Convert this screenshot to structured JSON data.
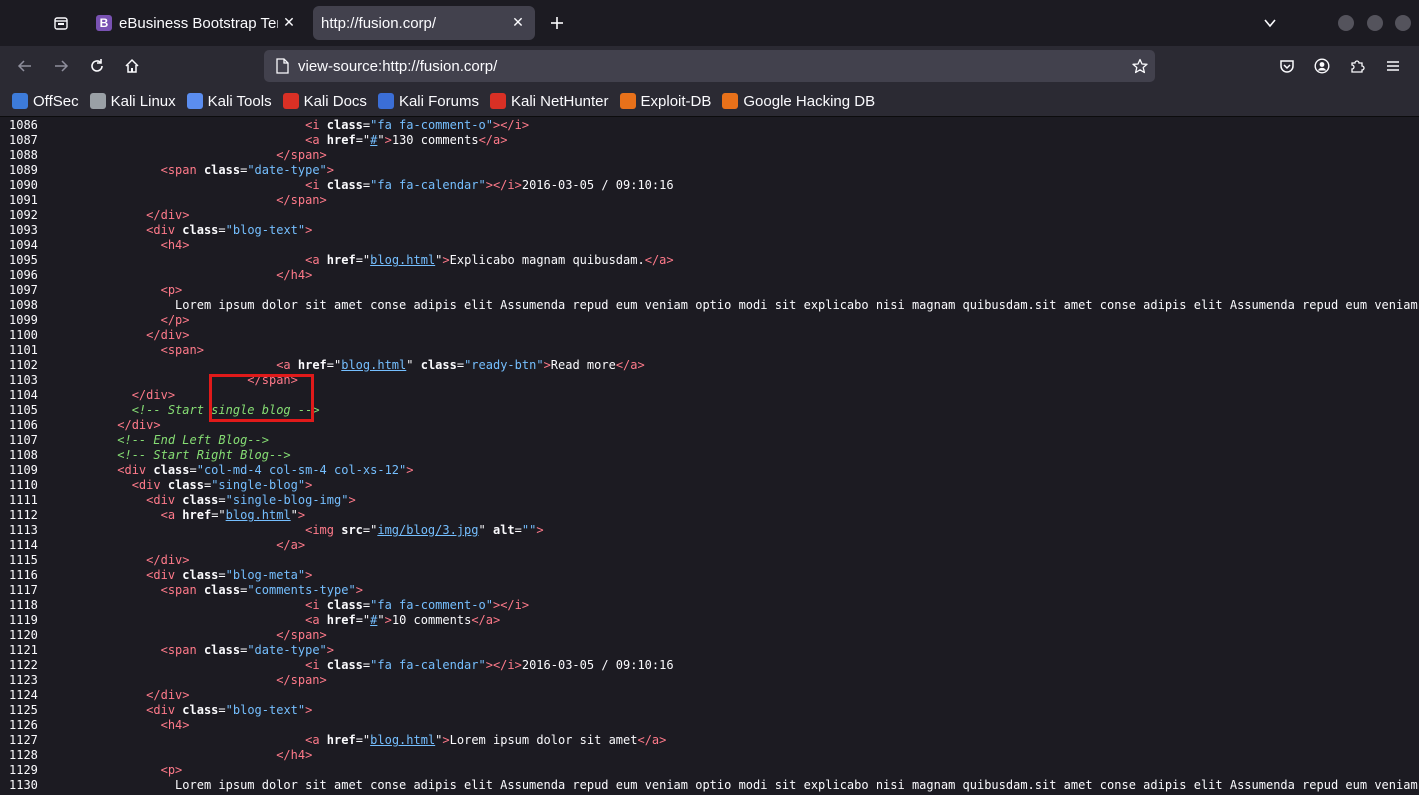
{
  "tabs": [
    {
      "title": "eBusiness Bootstrap Template",
      "favicon": "B",
      "active": false
    },
    {
      "title": "http://fusion.corp/",
      "active": true
    }
  ],
  "nav": {
    "url": "view-source:http://fusion.corp/"
  },
  "bookmarks": [
    {
      "label": "OffSec",
      "icon": "offsec-icon",
      "color": "#3d7bd9"
    },
    {
      "label": "Kali Linux",
      "icon": "kali-dragon-icon",
      "color": "#9aa0a6"
    },
    {
      "label": "Kali Tools",
      "icon": "kali-tools-icon",
      "color": "#5b8def"
    },
    {
      "label": "Kali Docs",
      "icon": "kali-docs-icon",
      "color": "#d93025"
    },
    {
      "label": "Kali Forums",
      "icon": "kali-forums-icon",
      "color": "#3b6ed6"
    },
    {
      "label": "Kali NetHunter",
      "icon": "nethunter-icon",
      "color": "#d93025"
    },
    {
      "label": "Exploit-DB",
      "icon": "exploit-db-icon",
      "color": "#e8711a"
    },
    {
      "label": "Google Hacking DB",
      "icon": "ghdb-icon",
      "color": "#e8711a"
    }
  ],
  "source_lines": [
    {
      "n": "1086",
      "parts": [
        [
          "sp",
          "                                    "
        ],
        [
          "tg",
          "<i "
        ],
        [
          "at",
          "class"
        ],
        [
          "tx",
          "="
        ],
        [
          "av",
          "\"fa fa-comment-o\""
        ],
        [
          "tg",
          "></i>"
        ]
      ]
    },
    {
      "n": "1087",
      "parts": [
        [
          "sp",
          "                                    "
        ],
        [
          "tg",
          "<a "
        ],
        [
          "at",
          "href"
        ],
        [
          "tx",
          "="
        ],
        [
          "tx",
          "\""
        ],
        [
          "lk",
          "#"
        ],
        [
          "tx",
          "\""
        ],
        [
          "tg",
          ">"
        ],
        [
          "tx",
          "130 comments"
        ],
        [
          "tg",
          "</a>"
        ]
      ]
    },
    {
      "n": "1088",
      "parts": [
        [
          "sp",
          "                                "
        ],
        [
          "tg",
          "</span>"
        ]
      ]
    },
    {
      "n": "1089",
      "parts": [
        [
          "sp",
          "                "
        ],
        [
          "tg",
          "<span "
        ],
        [
          "at",
          "class"
        ],
        [
          "tx",
          "="
        ],
        [
          "av",
          "\"date-type\""
        ],
        [
          "tg",
          ">"
        ]
      ]
    },
    {
      "n": "1090",
      "parts": [
        [
          "sp",
          "                                    "
        ],
        [
          "tg",
          "<i "
        ],
        [
          "at",
          "class"
        ],
        [
          "tx",
          "="
        ],
        [
          "av",
          "\"fa fa-calendar\""
        ],
        [
          "tg",
          "></i>"
        ],
        [
          "tx",
          "2016-03-05 / 09:10:16"
        ]
      ]
    },
    {
      "n": "1091",
      "parts": [
        [
          "sp",
          "                                "
        ],
        [
          "tg",
          "</span>"
        ]
      ]
    },
    {
      "n": "1092",
      "parts": [
        [
          "sp",
          "              "
        ],
        [
          "tg",
          "</div>"
        ]
      ]
    },
    {
      "n": "1093",
      "parts": [
        [
          "sp",
          "              "
        ],
        [
          "tg",
          "<div "
        ],
        [
          "at",
          "class"
        ],
        [
          "tx",
          "="
        ],
        [
          "av",
          "\"blog-text\""
        ],
        [
          "tg",
          ">"
        ]
      ]
    },
    {
      "n": "1094",
      "parts": [
        [
          "sp",
          "                "
        ],
        [
          "tg",
          "<h4>"
        ]
      ]
    },
    {
      "n": "1095",
      "parts": [
        [
          "sp",
          "                                    "
        ],
        [
          "tg",
          "<a "
        ],
        [
          "at",
          "href"
        ],
        [
          "tx",
          "=\""
        ],
        [
          "lk",
          "blog.html"
        ],
        [
          "tx",
          "\""
        ],
        [
          "tg",
          ">"
        ],
        [
          "tx",
          "Explicabo magnam quibusdam."
        ],
        [
          "tg",
          "</a>"
        ]
      ]
    },
    {
      "n": "1096",
      "parts": [
        [
          "sp",
          "                                "
        ],
        [
          "tg",
          "</h4>"
        ]
      ]
    },
    {
      "n": "1097",
      "parts": [
        [
          "sp",
          "                "
        ],
        [
          "tg",
          "<p>"
        ]
      ]
    },
    {
      "n": "1098",
      "parts": [
        [
          "sp",
          "                  "
        ],
        [
          "tx",
          "Lorem ipsum dolor sit amet conse adipis elit Assumenda repud eum veniam optio modi sit explicabo nisi magnam quibusdam.sit amet conse adipis elit Assumenda repud eum veniam"
        ]
      ]
    },
    {
      "n": "1099",
      "parts": [
        [
          "sp",
          "                "
        ],
        [
          "tg",
          "</p>"
        ]
      ]
    },
    {
      "n": "1100",
      "parts": [
        [
          "sp",
          "              "
        ],
        [
          "tg",
          "</div>"
        ]
      ]
    },
    {
      "n": "1101",
      "parts": [
        [
          "sp",
          "                "
        ],
        [
          "tg",
          "<span>"
        ]
      ]
    },
    {
      "n": "1102",
      "parts": [
        [
          "sp",
          "                                "
        ],
        [
          "tg",
          "<a "
        ],
        [
          "at",
          "href"
        ],
        [
          "tx",
          "=\""
        ],
        [
          "lk",
          "blog.html"
        ],
        [
          "tx",
          "\" "
        ],
        [
          "at",
          "class"
        ],
        [
          "tx",
          "="
        ],
        [
          "av",
          "\"ready-btn\""
        ],
        [
          "tg",
          ">"
        ],
        [
          "tx",
          "Read more"
        ],
        [
          "tg",
          "</a>"
        ]
      ]
    },
    {
      "n": "1103",
      "parts": [
        [
          "sp",
          "                            "
        ],
        [
          "tg",
          "</span>"
        ]
      ]
    },
    {
      "n": "1104",
      "parts": [
        [
          "sp",
          "            "
        ],
        [
          "tg",
          "</div>"
        ]
      ]
    },
    {
      "n": "1105",
      "parts": [
        [
          "sp",
          "            "
        ],
        [
          "cm",
          "<!-- Start single blog -->"
        ]
      ]
    },
    {
      "n": "1106",
      "parts": [
        [
          "sp",
          "          "
        ],
        [
          "tg",
          "</div>"
        ]
      ]
    },
    {
      "n": "1107",
      "parts": [
        [
          "sp",
          "          "
        ],
        [
          "cm",
          "<!-- End Left Blog-->"
        ]
      ]
    },
    {
      "n": "1108",
      "parts": [
        [
          "sp",
          "          "
        ],
        [
          "cm",
          "<!-- Start Right Blog-->"
        ]
      ]
    },
    {
      "n": "1109",
      "parts": [
        [
          "sp",
          "          "
        ],
        [
          "tg",
          "<div "
        ],
        [
          "at",
          "class"
        ],
        [
          "tx",
          "="
        ],
        [
          "av",
          "\"col-md-4 col-sm-4 col-xs-12\""
        ],
        [
          "tg",
          ">"
        ]
      ]
    },
    {
      "n": "1110",
      "parts": [
        [
          "sp",
          "            "
        ],
        [
          "tg",
          "<div "
        ],
        [
          "at",
          "class"
        ],
        [
          "tx",
          "="
        ],
        [
          "av",
          "\"single-blog\""
        ],
        [
          "tg",
          ">"
        ]
      ]
    },
    {
      "n": "1111",
      "parts": [
        [
          "sp",
          "              "
        ],
        [
          "tg",
          "<div "
        ],
        [
          "at",
          "class"
        ],
        [
          "tx",
          "="
        ],
        [
          "av",
          "\"single-blog-img\""
        ],
        [
          "tg",
          ">"
        ]
      ]
    },
    {
      "n": "1112",
      "parts": [
        [
          "sp",
          "                "
        ],
        [
          "tg",
          "<a "
        ],
        [
          "at",
          "href"
        ],
        [
          "tx",
          "=\""
        ],
        [
          "lk",
          "blog.html"
        ],
        [
          "tx",
          "\""
        ],
        [
          "tg",
          ">"
        ]
      ]
    },
    {
      "n": "1113",
      "parts": [
        [
          "sp",
          "                                    "
        ],
        [
          "tg",
          "<img "
        ],
        [
          "at",
          "src"
        ],
        [
          "tx",
          "=\""
        ],
        [
          "lk",
          "img/blog/3.jpg"
        ],
        [
          "tx",
          "\" "
        ],
        [
          "at",
          "alt"
        ],
        [
          "tx",
          "="
        ],
        [
          "av",
          "\"\""
        ],
        [
          "tg",
          ">"
        ]
      ]
    },
    {
      "n": "1114",
      "parts": [
        [
          "sp",
          "                                "
        ],
        [
          "tg",
          "</a>"
        ]
      ]
    },
    {
      "n": "1115",
      "parts": [
        [
          "sp",
          "              "
        ],
        [
          "tg",
          "</div>"
        ]
      ]
    },
    {
      "n": "1116",
      "parts": [
        [
          "sp",
          "              "
        ],
        [
          "tg",
          "<div "
        ],
        [
          "at",
          "class"
        ],
        [
          "tx",
          "="
        ],
        [
          "av",
          "\"blog-meta\""
        ],
        [
          "tg",
          ">"
        ]
      ]
    },
    {
      "n": "1117",
      "parts": [
        [
          "sp",
          "                "
        ],
        [
          "tg",
          "<span "
        ],
        [
          "at",
          "class"
        ],
        [
          "tx",
          "="
        ],
        [
          "av",
          "\"comments-type\""
        ],
        [
          "tg",
          ">"
        ]
      ]
    },
    {
      "n": "1118",
      "parts": [
        [
          "sp",
          "                                    "
        ],
        [
          "tg",
          "<i "
        ],
        [
          "at",
          "class"
        ],
        [
          "tx",
          "="
        ],
        [
          "av",
          "\"fa fa-comment-o\""
        ],
        [
          "tg",
          "></i>"
        ]
      ]
    },
    {
      "n": "1119",
      "parts": [
        [
          "sp",
          "                                    "
        ],
        [
          "tg",
          "<a "
        ],
        [
          "at",
          "href"
        ],
        [
          "tx",
          "=\""
        ],
        [
          "lk",
          "#"
        ],
        [
          "tx",
          "\""
        ],
        [
          "tg",
          ">"
        ],
        [
          "tx",
          "10 comments"
        ],
        [
          "tg",
          "</a>"
        ]
      ]
    },
    {
      "n": "1120",
      "parts": [
        [
          "sp",
          "                                "
        ],
        [
          "tg",
          "</span>"
        ]
      ]
    },
    {
      "n": "1121",
      "parts": [
        [
          "sp",
          "                "
        ],
        [
          "tg",
          "<span "
        ],
        [
          "at",
          "class"
        ],
        [
          "tx",
          "="
        ],
        [
          "av",
          "\"date-type\""
        ],
        [
          "tg",
          ">"
        ]
      ]
    },
    {
      "n": "1122",
      "parts": [
        [
          "sp",
          "                                    "
        ],
        [
          "tg",
          "<i "
        ],
        [
          "at",
          "class"
        ],
        [
          "tx",
          "="
        ],
        [
          "av",
          "\"fa fa-calendar\""
        ],
        [
          "tg",
          "></i>"
        ],
        [
          "tx",
          "2016-03-05 / 09:10:16"
        ]
      ]
    },
    {
      "n": "1123",
      "parts": [
        [
          "sp",
          "                                "
        ],
        [
          "tg",
          "</span>"
        ]
      ]
    },
    {
      "n": "1124",
      "parts": [
        [
          "sp",
          "              "
        ],
        [
          "tg",
          "</div>"
        ]
      ]
    },
    {
      "n": "1125",
      "parts": [
        [
          "sp",
          "              "
        ],
        [
          "tg",
          "<div "
        ],
        [
          "at",
          "class"
        ],
        [
          "tx",
          "="
        ],
        [
          "av",
          "\"blog-text\""
        ],
        [
          "tg",
          ">"
        ]
      ]
    },
    {
      "n": "1126",
      "parts": [
        [
          "sp",
          "                "
        ],
        [
          "tg",
          "<h4>"
        ]
      ]
    },
    {
      "n": "1127",
      "parts": [
        [
          "sp",
          "                                    "
        ],
        [
          "tg",
          "<a "
        ],
        [
          "at",
          "href"
        ],
        [
          "tx",
          "=\""
        ],
        [
          "lk",
          "blog.html"
        ],
        [
          "tx",
          "\""
        ],
        [
          "tg",
          ">"
        ],
        [
          "tx",
          "Lorem ipsum dolor sit amet"
        ],
        [
          "tg",
          "</a>"
        ]
      ]
    },
    {
      "n": "1128",
      "parts": [
        [
          "sp",
          "                                "
        ],
        [
          "tg",
          "</h4>"
        ]
      ]
    },
    {
      "n": "1129",
      "parts": [
        [
          "sp",
          "                "
        ],
        [
          "tg",
          "<p>"
        ]
      ]
    },
    {
      "n": "1130",
      "parts": [
        [
          "sp",
          "                  "
        ],
        [
          "tx",
          "Lorem ipsum dolor sit amet conse adipis elit Assumenda repud eum veniam optio modi sit explicabo nisi magnam quibusdam.sit amet conse adipis elit Assumenda repud eum veniam"
        ]
      ]
    }
  ],
  "colors": {
    "tag": "#ff7a8a",
    "attr_value": "#75bfff",
    "comment": "#86de74",
    "highlight": "#e01a1a"
  }
}
